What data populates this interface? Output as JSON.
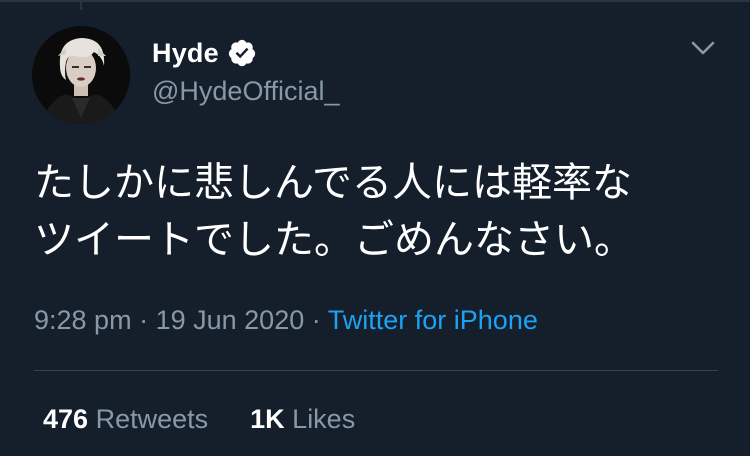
{
  "user": {
    "display_name": "Hyde",
    "handle": "@HydeOfficial_",
    "verified": true,
    "avatar_icon": "profile-photo"
  },
  "tweet": {
    "line1": "たしかに悲しんでる人には軽率な",
    "line2": "ツイートでした。ごめんなさい。",
    "time": "9:28 pm",
    "date": "19 Jun 2020",
    "separator": "·",
    "source": "Twitter for iPhone"
  },
  "stats": {
    "retweets_count": "476",
    "retweets_label": "Retweets",
    "likes_count": "1K",
    "likes_label": "Likes"
  },
  "colors": {
    "background": "#151f2b",
    "primary_text": "#ffffff",
    "secondary_text": "#8899a6",
    "accent": "#1da1f2",
    "divider": "#38444d"
  },
  "icons": {
    "verified": "verified-badge-icon",
    "menu": "chevron-down-icon"
  }
}
